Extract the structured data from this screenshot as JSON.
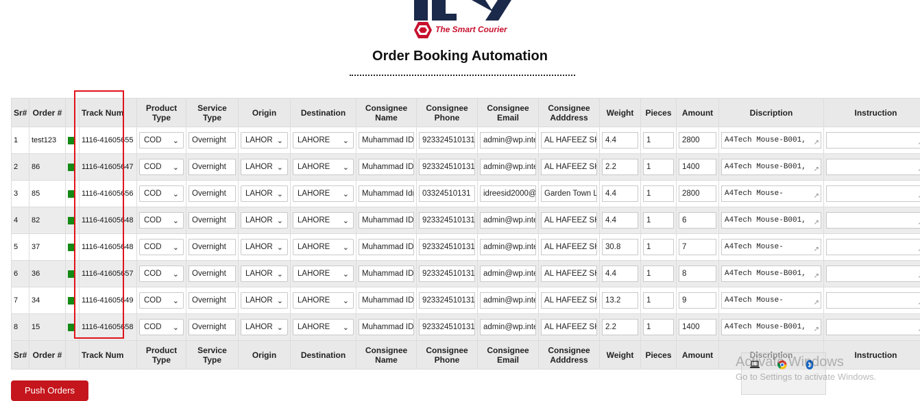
{
  "brand": {
    "tagline": "The Smart Courier",
    "accent_color": "#c8102e",
    "navy_color": "#1b2a4a"
  },
  "page": {
    "title": "Order Booking Automation"
  },
  "table": {
    "headers": [
      "Sr#",
      "Order #",
      "",
      "Track Num",
      "Product Type",
      "Service Type",
      "Origin",
      "Destination",
      "Consignee Name",
      "Consignee Phone",
      "Consignee Email",
      "Consignee Adddress",
      "Weight",
      "Pieces",
      "Amount",
      "Discription",
      "Instruction"
    ],
    "rows": [
      {
        "sr": "1",
        "order": "test123",
        "track": "1116-41605655",
        "product": "COD",
        "service": "Overnight",
        "origin": "LAHOR",
        "destination": "LAHORE",
        "name": "Muhammad IDI",
        "phone": "923324510131",
        "email": "admin@wp.inte",
        "address": "AL HAFEEZ SH",
        "weight": "4.4",
        "pieces": "1",
        "amount": "2800",
        "description": "A4Tech Mouse-B001,",
        "instruction": ""
      },
      {
        "sr": "2",
        "order": "86",
        "track": "1116-41605647",
        "product": "COD",
        "service": "Overnight",
        "origin": "LAHOR",
        "destination": "LAHORE",
        "name": "Muhammad IDI",
        "phone": "923324510131",
        "email": "admin@wp.inte",
        "address": "AL HAFEEZ SH",
        "weight": "2.2",
        "pieces": "1",
        "amount": "1400",
        "description": "A4Tech Mouse-B001,",
        "instruction": ""
      },
      {
        "sr": "3",
        "order": "85",
        "track": "1116-41605656",
        "product": "COD",
        "service": "Overnight",
        "origin": "LAHOR",
        "destination": "LAHORE",
        "name": "Muhammad Idr",
        "phone": "03324510131",
        "email": "idreesid2000@",
        "address": "Garden Town L",
        "weight": "4.4",
        "pieces": "1",
        "amount": "2800",
        "description": "A4Tech Mouse-",
        "instruction": ""
      },
      {
        "sr": "4",
        "order": "82",
        "track": "1116-41605648",
        "product": "COD",
        "service": "Overnight",
        "origin": "LAHOR",
        "destination": "LAHORE",
        "name": "Muhammad IDI",
        "phone": "923324510131",
        "email": "admin@wp.inte",
        "address": "AL HAFEEZ SH",
        "weight": "4.4",
        "pieces": "1",
        "amount": "6",
        "description": "A4Tech Mouse-B001,",
        "instruction": ""
      },
      {
        "sr": "5",
        "order": "37",
        "track": "1116-41605648",
        "product": "COD",
        "service": "Overnight",
        "origin": "LAHOR",
        "destination": "LAHORE",
        "name": "Muhammad IDI",
        "phone": "923324510131",
        "email": "admin@wp.inte",
        "address": "AL HAFEEZ SH",
        "weight": "30.8",
        "pieces": "1",
        "amount": "7",
        "description": "A4Tech Mouse-",
        "instruction": ""
      },
      {
        "sr": "6",
        "order": "36",
        "track": "1116-41605657",
        "product": "COD",
        "service": "Overnight",
        "origin": "LAHOR",
        "destination": "LAHORE",
        "name": "Muhammad IDI",
        "phone": "923324510131",
        "email": "admin@wp.inte",
        "address": "AL HAFEEZ SH",
        "weight": "4.4",
        "pieces": "1",
        "amount": "8",
        "description": "A4Tech Mouse-B001,",
        "instruction": ""
      },
      {
        "sr": "7",
        "order": "34",
        "track": "1116-41605649",
        "product": "COD",
        "service": "Overnight",
        "origin": "LAHOR",
        "destination": "LAHORE",
        "name": "Muhammad IDI",
        "phone": "923324510131",
        "email": "admin@wp.inte",
        "address": "AL HAFEEZ SH",
        "weight": "13.2",
        "pieces": "1",
        "amount": "9",
        "description": "A4Tech Mouse-",
        "instruction": ""
      },
      {
        "sr": "8",
        "order": "15",
        "track": "1116-41605658",
        "product": "COD",
        "service": "Overnight",
        "origin": "LAHOR",
        "destination": "LAHORE",
        "name": "Muhammad IDI",
        "phone": "923324510131",
        "email": "admin@wp.inte",
        "address": "AL HAFEEZ SH",
        "weight": "2.2",
        "pieces": "1",
        "amount": "1400",
        "description": "A4Tech Mouse-B001,",
        "instruction": ""
      }
    ]
  },
  "actions": {
    "push_label": "Push Orders"
  },
  "watermark": {
    "line1": "Activate Windows",
    "line2": "Go to Settings to activate Windows."
  },
  "colors": {
    "status_green": "#148a14",
    "highlight_red": "#e0121a",
    "button_red": "#c4161c"
  }
}
